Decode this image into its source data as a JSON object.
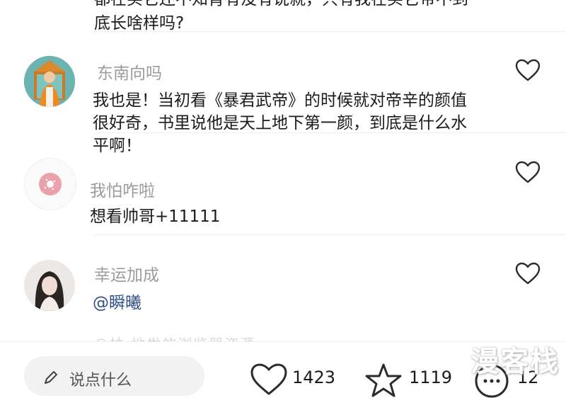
{
  "previous_comment": {
    "line1": "都在买它还不知肯有没有说就，只有我在买它带不到",
    "line2": "底长啥样吗?"
  },
  "comments": [
    {
      "username": "东南向吗",
      "text_lines": [
        "我也是！当初看《暴君武帝》的时候就对帝辛的颜值",
        "很好奇，书里说他是天上地下第一颜，到底是什么水",
        "平啊！"
      ]
    },
    {
      "username": "我怕咋啦",
      "text": "想看帅哥+11111"
    },
    {
      "username": "幸运加成",
      "text": "@瞬曦"
    }
  ],
  "partial_comment": "@扶  地发的浏览器资源",
  "bottom_bar": {
    "input_placeholder": "说点什么",
    "like_count": "1423",
    "star_count": "1119",
    "comment_count": "12"
  },
  "watermark": "漫客栈",
  "colors": {
    "username": "#9b9b9b",
    "mention": "#2c4f86",
    "text": "#1b1b1b"
  },
  "icons": [
    "heart-icon",
    "star-icon",
    "comment-bubble-icon",
    "pen-icon"
  ]
}
